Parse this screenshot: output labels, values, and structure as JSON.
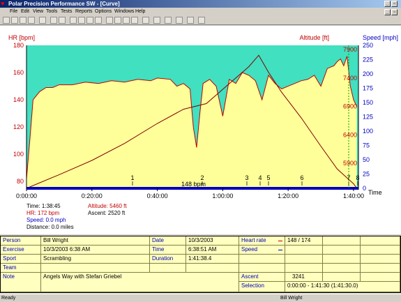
{
  "window": {
    "title": "Polar Precision Performance SW - [Curve]"
  },
  "menu": [
    "File",
    "Edit",
    "View",
    "Tools",
    "Tests",
    "Reports",
    "Options",
    "Windows",
    "Help"
  ],
  "axes": {
    "hr_label": "HR [bpm]",
    "alt_label": "Altitude [ft]",
    "speed_label": "Speed [mph]",
    "time_label": "Time",
    "hr_ticks": [
      "180",
      "160",
      "140",
      "120",
      "100",
      "80"
    ],
    "alt_ticks": [
      "7900",
      "7400",
      "6900",
      "6400",
      "5900"
    ],
    "speed_ticks": [
      "250",
      "225",
      "200",
      "175",
      "150",
      "125",
      "100",
      "75",
      "50",
      "25",
      "0"
    ],
    "time_ticks": [
      "0:00:00",
      "0:20:00",
      "0:40:00",
      "1:00:00",
      "1:20:00",
      "1:40:00"
    ],
    "laps": [
      "1",
      "2",
      "3",
      "4",
      "5",
      "6",
      "7",
      "8"
    ],
    "avg_label": "148 bpm"
  },
  "chart_data": {
    "type": "line",
    "x_unit": "minutes",
    "series": [
      {
        "axis": "hr",
        "x": [
          0,
          1,
          2,
          4,
          6,
          8,
          10,
          14,
          18,
          22,
          26,
          30,
          34,
          38,
          40,
          44,
          46,
          48,
          50,
          51,
          52,
          53,
          54,
          56,
          58,
          60,
          62,
          64,
          66,
          68,
          70,
          72,
          74,
          76,
          78,
          80,
          82,
          84,
          86,
          88,
          90,
          92,
          94,
          95,
          96,
          97,
          98,
          99,
          100,
          101
        ],
        "y": [
          82,
          110,
          140,
          146,
          149,
          149,
          151,
          151,
          153,
          152,
          154,
          153,
          155,
          154,
          156,
          155,
          150,
          152,
          148,
          120,
          105,
          130,
          152,
          155,
          150,
          128,
          155,
          152,
          160,
          158,
          154,
          140,
          158,
          152,
          148,
          150,
          152,
          154,
          155,
          158,
          150,
          163,
          165,
          168,
          170,
          165,
          172,
          150,
          140,
          135
        ]
      },
      {
        "axis": "alt",
        "x": [
          0,
          10,
          20,
          30,
          40,
          48,
          55,
          62,
          68,
          71,
          74,
          78,
          84,
          90,
          95,
          100,
          101
        ],
        "y": [
          5460,
          5700,
          5950,
          6250,
          6600,
          6850,
          6950,
          7300,
          7600,
          7800,
          7500,
          7150,
          6700,
          6200,
          5800,
          5540,
          5460
        ]
      }
    ]
  },
  "cursor": {
    "time": "Time: 1:38:45",
    "hr": "HR: 172 bpm",
    "speed": "Speed: 0.0 mph",
    "distance": "Distance: 0.0 miles",
    "altitude": "Altitude: 5460 ft",
    "ascent": "Ascent: 2520 ft"
  },
  "table": {
    "person_l": "Person",
    "person_v": "Bill Wright",
    "exercise_l": "Exercise",
    "exercise_v": "10/3/2003 6:38 AM",
    "sport_l": "Sport",
    "sport_v": "Scrambling",
    "team_l": "Team",
    "team_v": "",
    "note_l": "Note",
    "note_v": "Angels Way with Stefan Griebel",
    "date_l": "Date",
    "date_v": "10/3/2003",
    "time_l": "Time",
    "time_v": "6:38:51 AM",
    "duration_l": "Duration",
    "duration_v": "1:41:38.4",
    "hr_l": "Heart rate",
    "hr_v": "148 / 174",
    "speed_l": "Speed",
    "speed_v": "",
    "ascent_l": "Ascent",
    "ascent_v": "3241",
    "selection_l": "Selection",
    "selection_v": "0:00:00 - 1:41:30 (1:41:30.0)"
  },
  "status": {
    "left": "Ready",
    "user": "Bill Wright"
  },
  "colors": {
    "fill_yellow": "#ffff99",
    "fill_teal": "#40e0c0",
    "hr_line": "#c00000",
    "alt_line": "#800000",
    "speed_axis": "#0000c0"
  }
}
